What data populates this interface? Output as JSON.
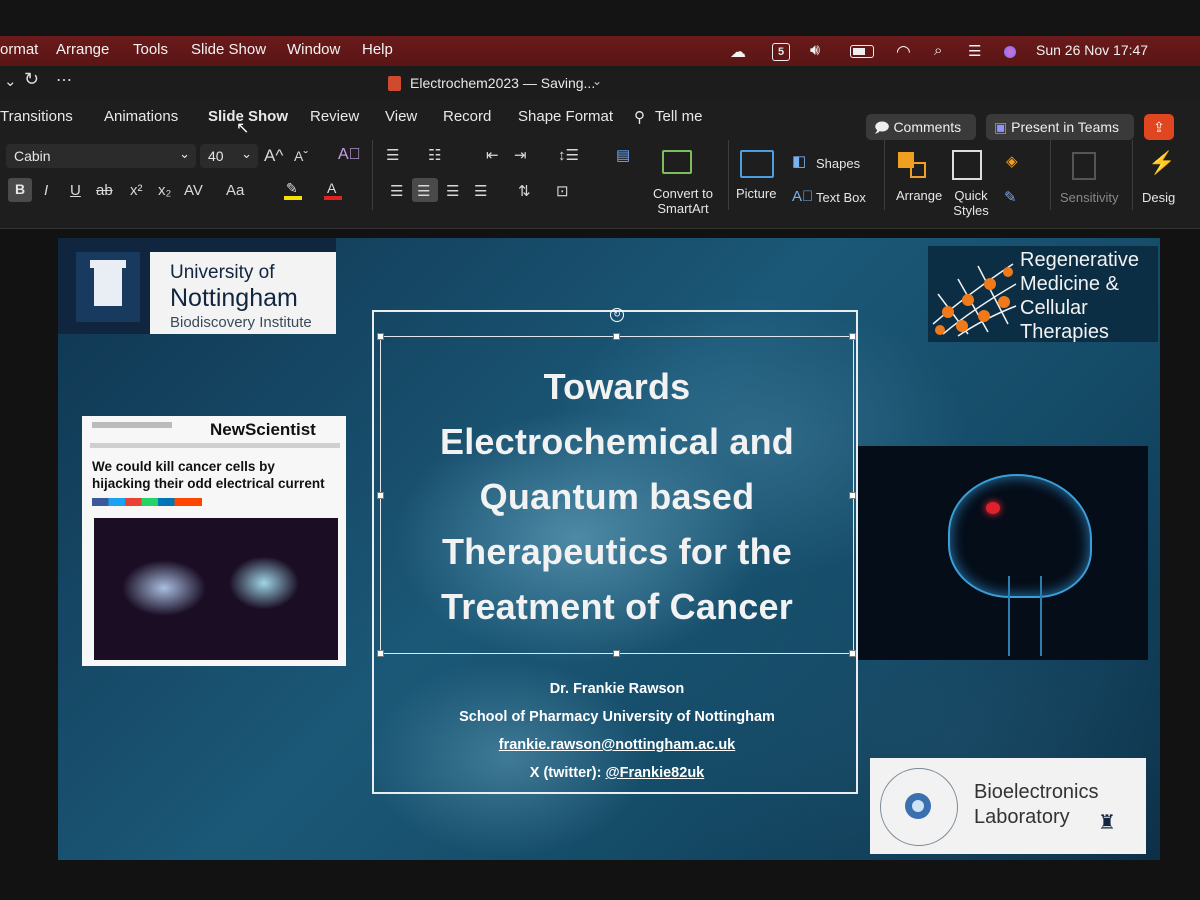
{
  "menubar": {
    "items": [
      "ormat",
      "Arrange",
      "Tools",
      "Slide Show",
      "Window",
      "Help"
    ],
    "datetime": "Sun 26 Nov  17:47"
  },
  "titlebar": {
    "document": "Electrochem2023 — Saving..."
  },
  "ribbon": {
    "tabs": [
      "Transitions",
      "Animations",
      "Slide Show",
      "Review",
      "View",
      "Record",
      "Shape Format",
      "Tell me"
    ],
    "comments": "Comments",
    "present": "Present in Teams",
    "font_name": "Cabin",
    "font_size": "40",
    "format_buttons": [
      "B",
      "I",
      "U",
      "ab",
      "x²",
      "x₂",
      "AV",
      "Aa"
    ],
    "convert_smartart": [
      "Convert to",
      "SmartArt"
    ],
    "picture": "Picture",
    "shapes": "Shapes",
    "text_box": "Text Box",
    "arrange": "Arrange",
    "quick_styles": [
      "Quick",
      "Styles"
    ],
    "sensitivity": "Sensitivity",
    "design": "Desig"
  },
  "slide": {
    "uon": {
      "name1": "University of",
      "name2": "Nottingham",
      "dept": "Biodiscovery Institute"
    },
    "rmct": {
      "line1": "Regenerative",
      "line2": "Medicine &",
      "line3": "Cellular",
      "line4": "Therapies"
    },
    "news": {
      "brand": "NewScientist",
      "headline1": "We could kill cancer cells by",
      "headline2": "hijacking their odd electrical current"
    },
    "title_lines": [
      "Towards",
      "Electrochemical and",
      "Quantum based",
      "Therapeutics for the",
      "Treatment of Cancer"
    ],
    "author": "Dr. Frankie Rawson",
    "affiliation": "School of Pharmacy University of Nottingham",
    "email": "frankie.rawson@nottingham.ac.uk",
    "twitter_label": "X (twitter): ",
    "twitter_handle": "@Frankie82uk",
    "bio": {
      "line1": "Bioelectronics",
      "line2": "Laboratory"
    }
  },
  "colors": {
    "menubar": "#5a1515",
    "slide_bg": "#1b5877",
    "comments_accent": "#3a3a3a",
    "share_button": "#e0461f"
  }
}
